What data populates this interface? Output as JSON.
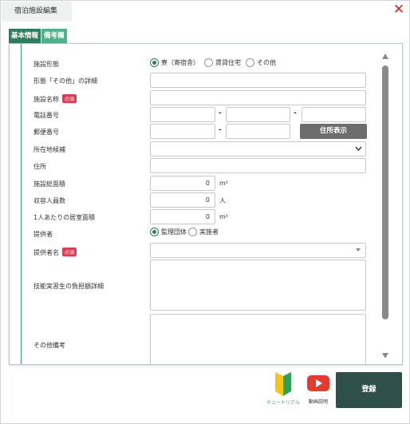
{
  "window": {
    "title": "宿泊施設編集"
  },
  "tabs": [
    {
      "label": "基本情報",
      "active": true
    },
    {
      "label": "備考欄",
      "active": false
    }
  ],
  "form": {
    "facility_type": {
      "label": "施設形態",
      "options": [
        "寮（寄宿舎）",
        "賃貸住宅",
        "その他"
      ],
      "selected": "寮（寄宿舎）"
    },
    "other_detail": {
      "label": "形態「その他」の詳細",
      "value": ""
    },
    "facility_name": {
      "label": "施設名称",
      "required_badge": "必須",
      "value": ""
    },
    "phone": {
      "label": "電話番号",
      "sep": "-",
      "values": [
        "",
        "",
        ""
      ]
    },
    "postal": {
      "label": "郵便番号",
      "sep": "-",
      "values": [
        "",
        ""
      ],
      "button": "住所表示"
    },
    "address_candidate": {
      "label": "所在地候補",
      "value": ""
    },
    "address": {
      "label": "住所",
      "value": ""
    },
    "total_area": {
      "label": "施設総面積",
      "value": "0",
      "unit": "m²"
    },
    "capacity": {
      "label": "収容人員数",
      "value": "0",
      "unit": "人"
    },
    "room_area": {
      "label": "1人あたりの居室面積",
      "value": "0",
      "unit": "m²"
    },
    "provider": {
      "label": "提供者",
      "options": [
        "監理団体",
        "実施者"
      ],
      "selected": "監理団体"
    },
    "provider_name": {
      "label": "提供者名",
      "required_badge": "必須",
      "value": ""
    },
    "cost_detail": {
      "label": "技能実習生の負担額詳細",
      "value": ""
    },
    "other_notes": {
      "label": "その他備考",
      "value": ""
    }
  },
  "footer": {
    "tutorial_label": "チュートリアル",
    "video_label": "動画説明",
    "register_label": "登録"
  },
  "colors": {
    "accent": "#2e7d5e",
    "tab_inactive": "#4fb28c",
    "required": "#e03b50",
    "close": "#d0261f",
    "register": "#2f4f4a"
  }
}
